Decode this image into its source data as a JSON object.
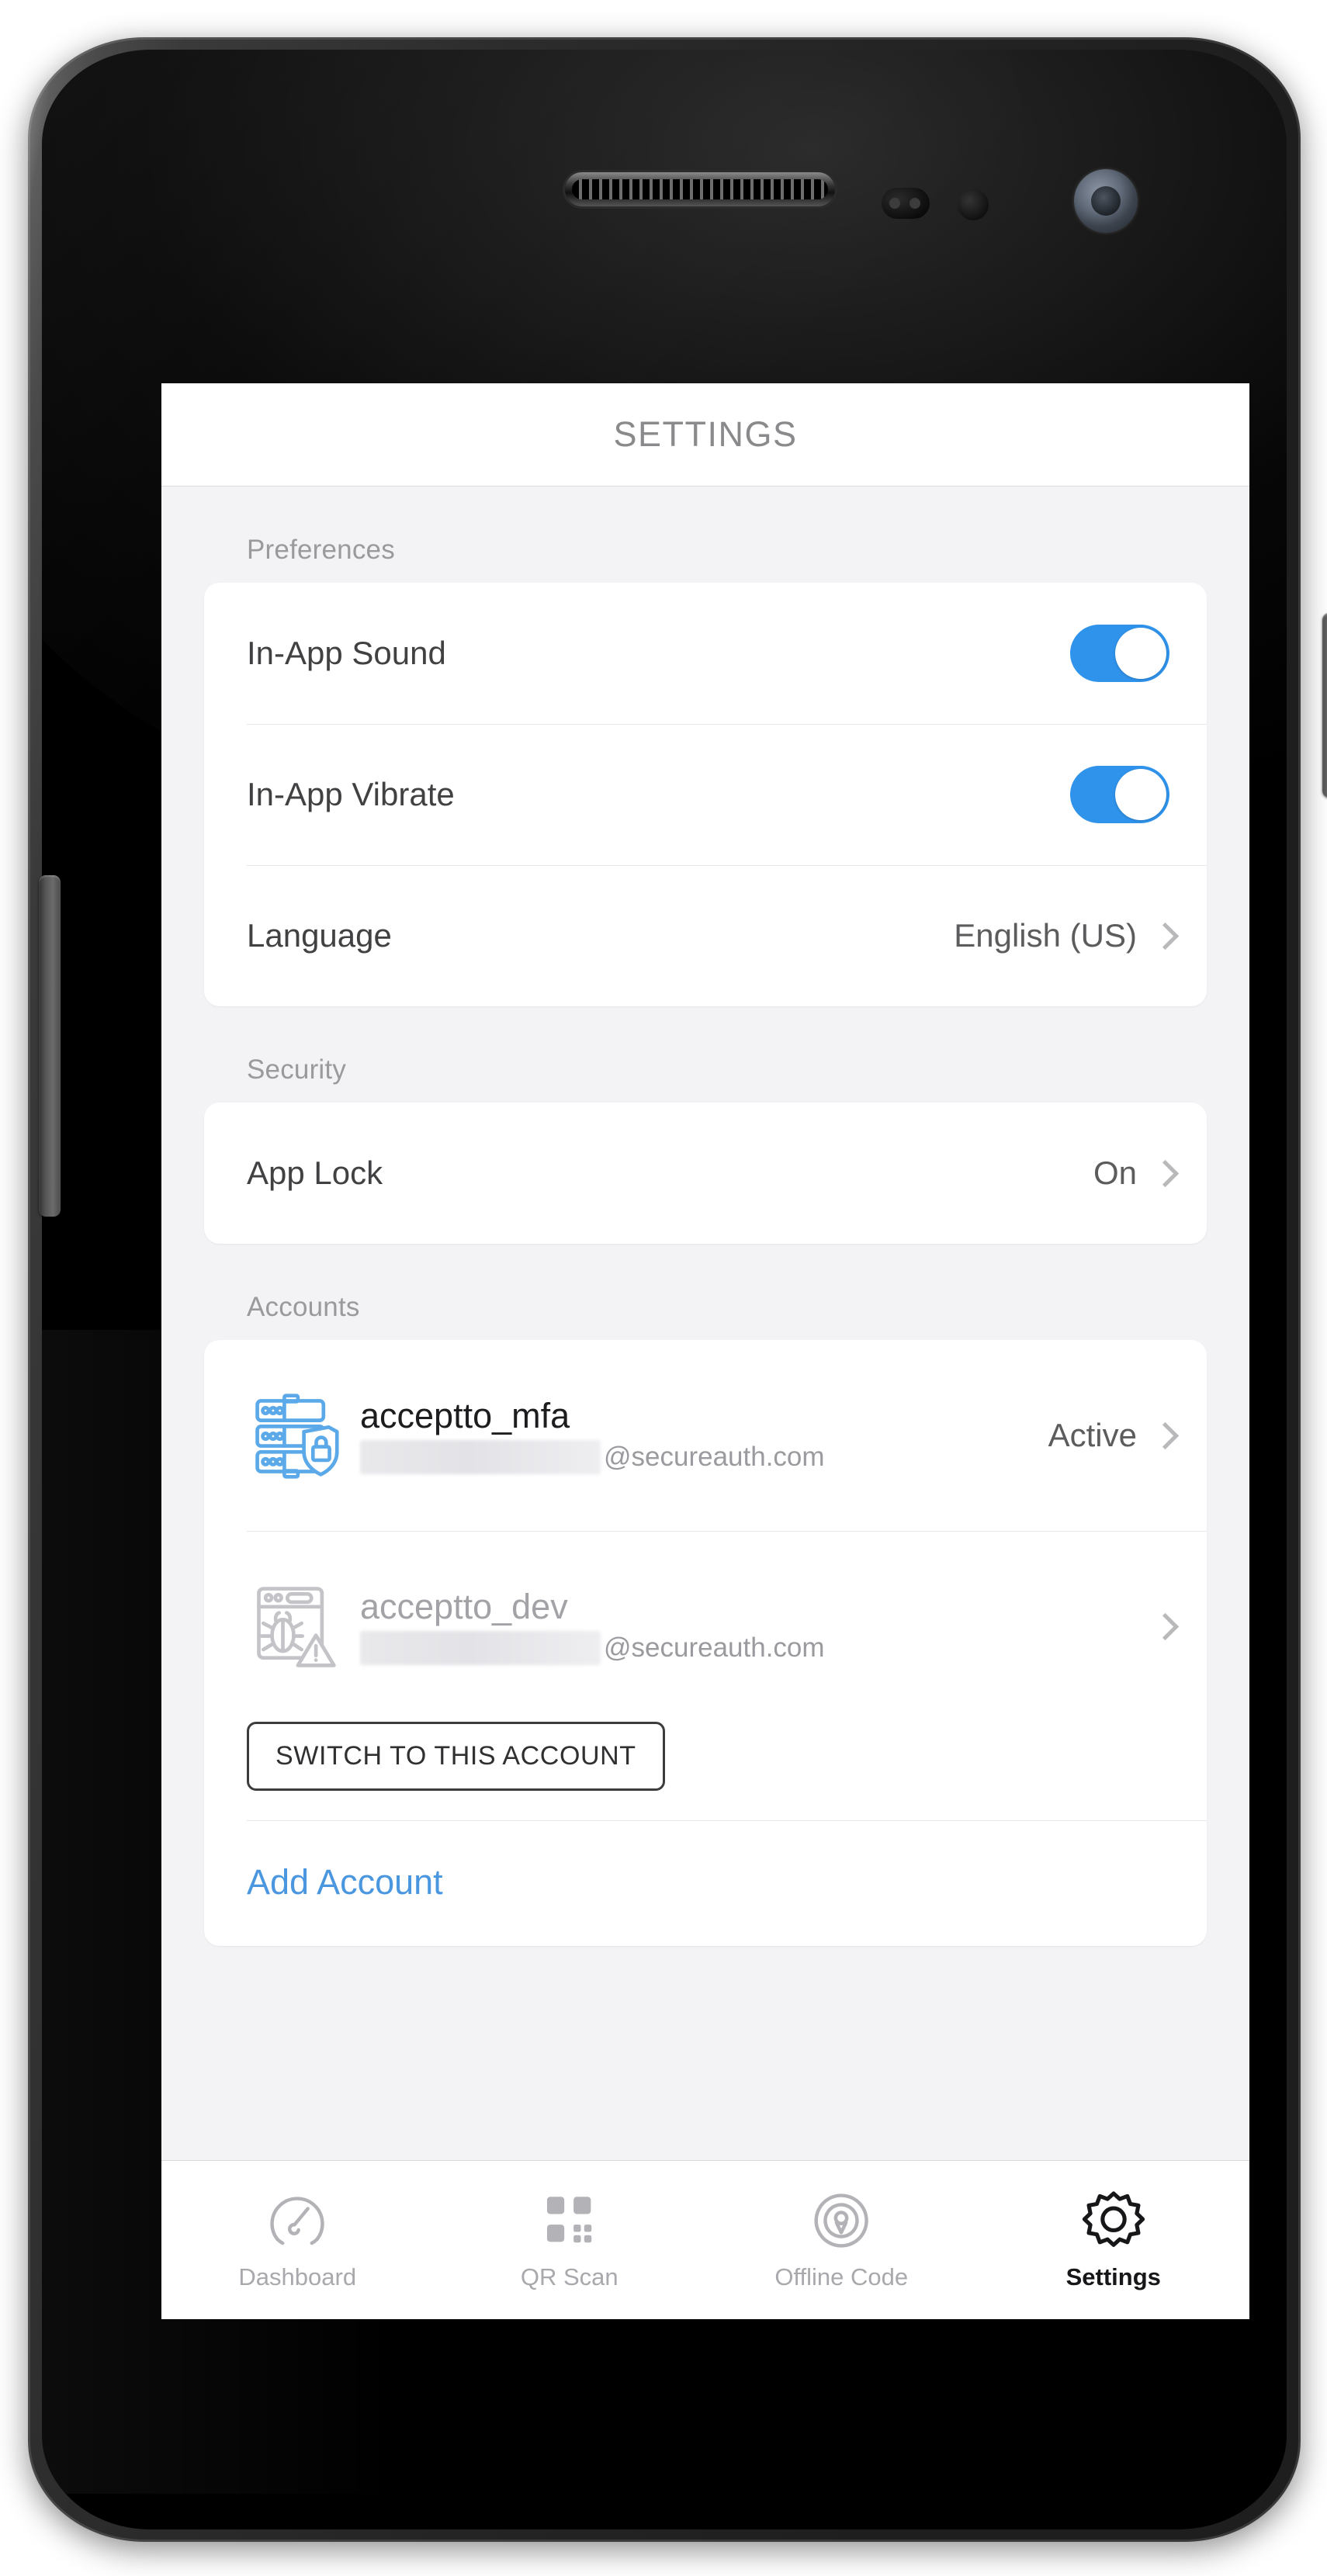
{
  "device": {
    "hardware": {
      "earpiece": "earpiece-speaker",
      "proximity_sensor": "proximity-sensor",
      "light_sensor": "ambient-light-sensor",
      "front_camera": "front-camera",
      "power_button": "power-button",
      "volume_button": "volume-rocker"
    }
  },
  "header": {
    "title": "SETTINGS"
  },
  "sections": [
    {
      "label": "Preferences",
      "rows": [
        {
          "label": "In-App Sound",
          "type": "toggle",
          "value": "on"
        },
        {
          "label": "In-App Vibrate",
          "type": "toggle",
          "value": "on"
        },
        {
          "label": "Language",
          "type": "link",
          "value": "English (US)"
        }
      ]
    },
    {
      "label": "Security",
      "rows": [
        {
          "label": "App Lock",
          "type": "link",
          "value": "On"
        }
      ]
    }
  ],
  "accounts": {
    "label": "Accounts",
    "items": [
      {
        "name": "acceptto_mfa",
        "username_redacted": "",
        "domain": "@secureauth.com",
        "status": "Active",
        "icon": "server-lock-icon",
        "active": true
      },
      {
        "name": "acceptto_dev",
        "username_redacted": "",
        "domain": "@secureauth.com",
        "status": "",
        "icon": "bug-warning-icon",
        "active": false
      }
    ],
    "switch_button_label": "SWITCH TO THIS ACCOUNT",
    "add_account_label": "Add Account"
  },
  "tabbar": {
    "tabs": [
      {
        "label": "Dashboard",
        "icon": "speedometer-icon",
        "active": false
      },
      {
        "label": "QR Scan",
        "icon": "qr-code-icon",
        "active": false
      },
      {
        "label": "Offline Code",
        "icon": "radar-pin-icon",
        "active": false
      },
      {
        "label": "Settings",
        "icon": "gear-icon",
        "active": true
      }
    ]
  },
  "colors": {
    "toggle_on": "#2f93ec",
    "link_blue": "#4a97e0",
    "account_icon_blue": "#5ba9e8",
    "account_icon_gray": "#c3c3c8",
    "screen_bg": "#f3f2f5",
    "card_bg": "#ffffff",
    "active_tab": "#17171a",
    "inactive_tab": "#a9a9ad"
  }
}
